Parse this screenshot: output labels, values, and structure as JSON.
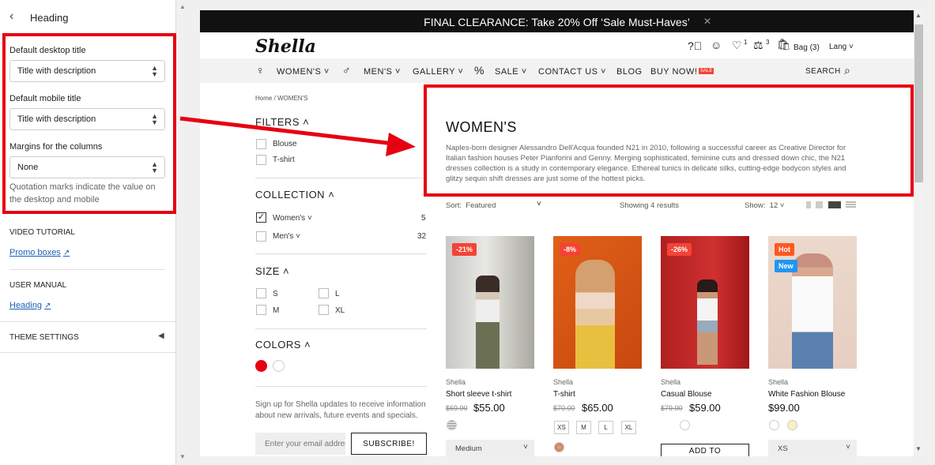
{
  "panel": {
    "title": "Heading",
    "desktop_label": "Default desktop title",
    "desktop_value": "Title with description",
    "mobile_label": "Default mobile title",
    "mobile_value": "Title with description",
    "margins_label": "Margins for the columns",
    "margins_value": "None",
    "note": "Quotation marks indicate the value on the desktop and mobile",
    "video_title": "VIDEO TUTORIAL",
    "video_link": "Promo boxes",
    "manual_title": "USER MANUAL",
    "manual_link": "Heading",
    "theme_settings": "THEME SETTINGS"
  },
  "store": {
    "announcement": "FINAL CLEARANCE: Take 20% Off ‘Sale Must-Haves’",
    "logo": "Shella",
    "wishlist_count": "1",
    "compare_count": "3",
    "bag": "Bag (3)",
    "lang": "Lang",
    "nav": [
      "WOMEN'S",
      "MEN'S",
      "GALLERY",
      "SALE",
      "CONTACT US",
      "BLOG",
      "BUY NOW!"
    ],
    "sale_tag": "SALE",
    "search": "SEARCH",
    "breadcrumb": "Home  /  WOMEN'S",
    "filters": "FILTERS",
    "filter_items": [
      "Blouse",
      "T-shirt"
    ],
    "collection": "COLLECTION",
    "collection_items": [
      {
        "label": "Women's",
        "count": "5"
      },
      {
        "label": "Men's",
        "count": "32"
      }
    ],
    "size": "SIZE",
    "sizes": [
      "S",
      "L",
      "M",
      "XL"
    ],
    "colors": "COLORS",
    "signup": "Sign up for Shella updates to receive information about new arrivals, future events and specials.",
    "email_placeholder": "Enter your email address",
    "subscribe": "SUBSCRIBE!",
    "collection_heading": "WOMEN'S",
    "collection_desc": "Naples-born designer Alessandro Dell'Acqua founded N21 in 2010, following a successful career as Creative Director for Italian fashion houses Peter Pianforini and Genny. Merging sophisticated, feminine cuts and dressed down chic, the N21 dresses collection is a study in contemporary elegance. Ethereal tunics in delicate silks, cutting-edge bodycon styles and glitzy sequin shift dresses are just some of the hottest picks.",
    "sort_label": "Sort:",
    "sort_value": "Featured",
    "results": "Showing 4 results",
    "show_label": "Show:",
    "show_value": "12",
    "products": [
      {
        "badge": "-21%",
        "brand": "Shella",
        "name": "Short sleeve t-shirt",
        "old": "$69.00",
        "price": "$55.00",
        "option": "Medium"
      },
      {
        "badge": "-8%",
        "brand": "Shella",
        "name": "T-shirt",
        "old": "$70.00",
        "price": "$65.00",
        "sizes": [
          "XS",
          "M",
          "L",
          "XL"
        ]
      },
      {
        "badge": "-26%",
        "brand": "Shella",
        "name": "Casual Blouse",
        "old": "$79.00",
        "price": "$59.00",
        "button": "ADD TO"
      },
      {
        "badge": "Hot",
        "badge2": "New",
        "brand": "Shella",
        "name": "White Fashion Blouse",
        "price": "$99.00",
        "option": "XS"
      }
    ]
  },
  "colors": {
    "accent_red": "#e60012",
    "sale_badge": "#f44336",
    "new_badge": "#2196f3",
    "hot_badge": "#ff5722"
  }
}
